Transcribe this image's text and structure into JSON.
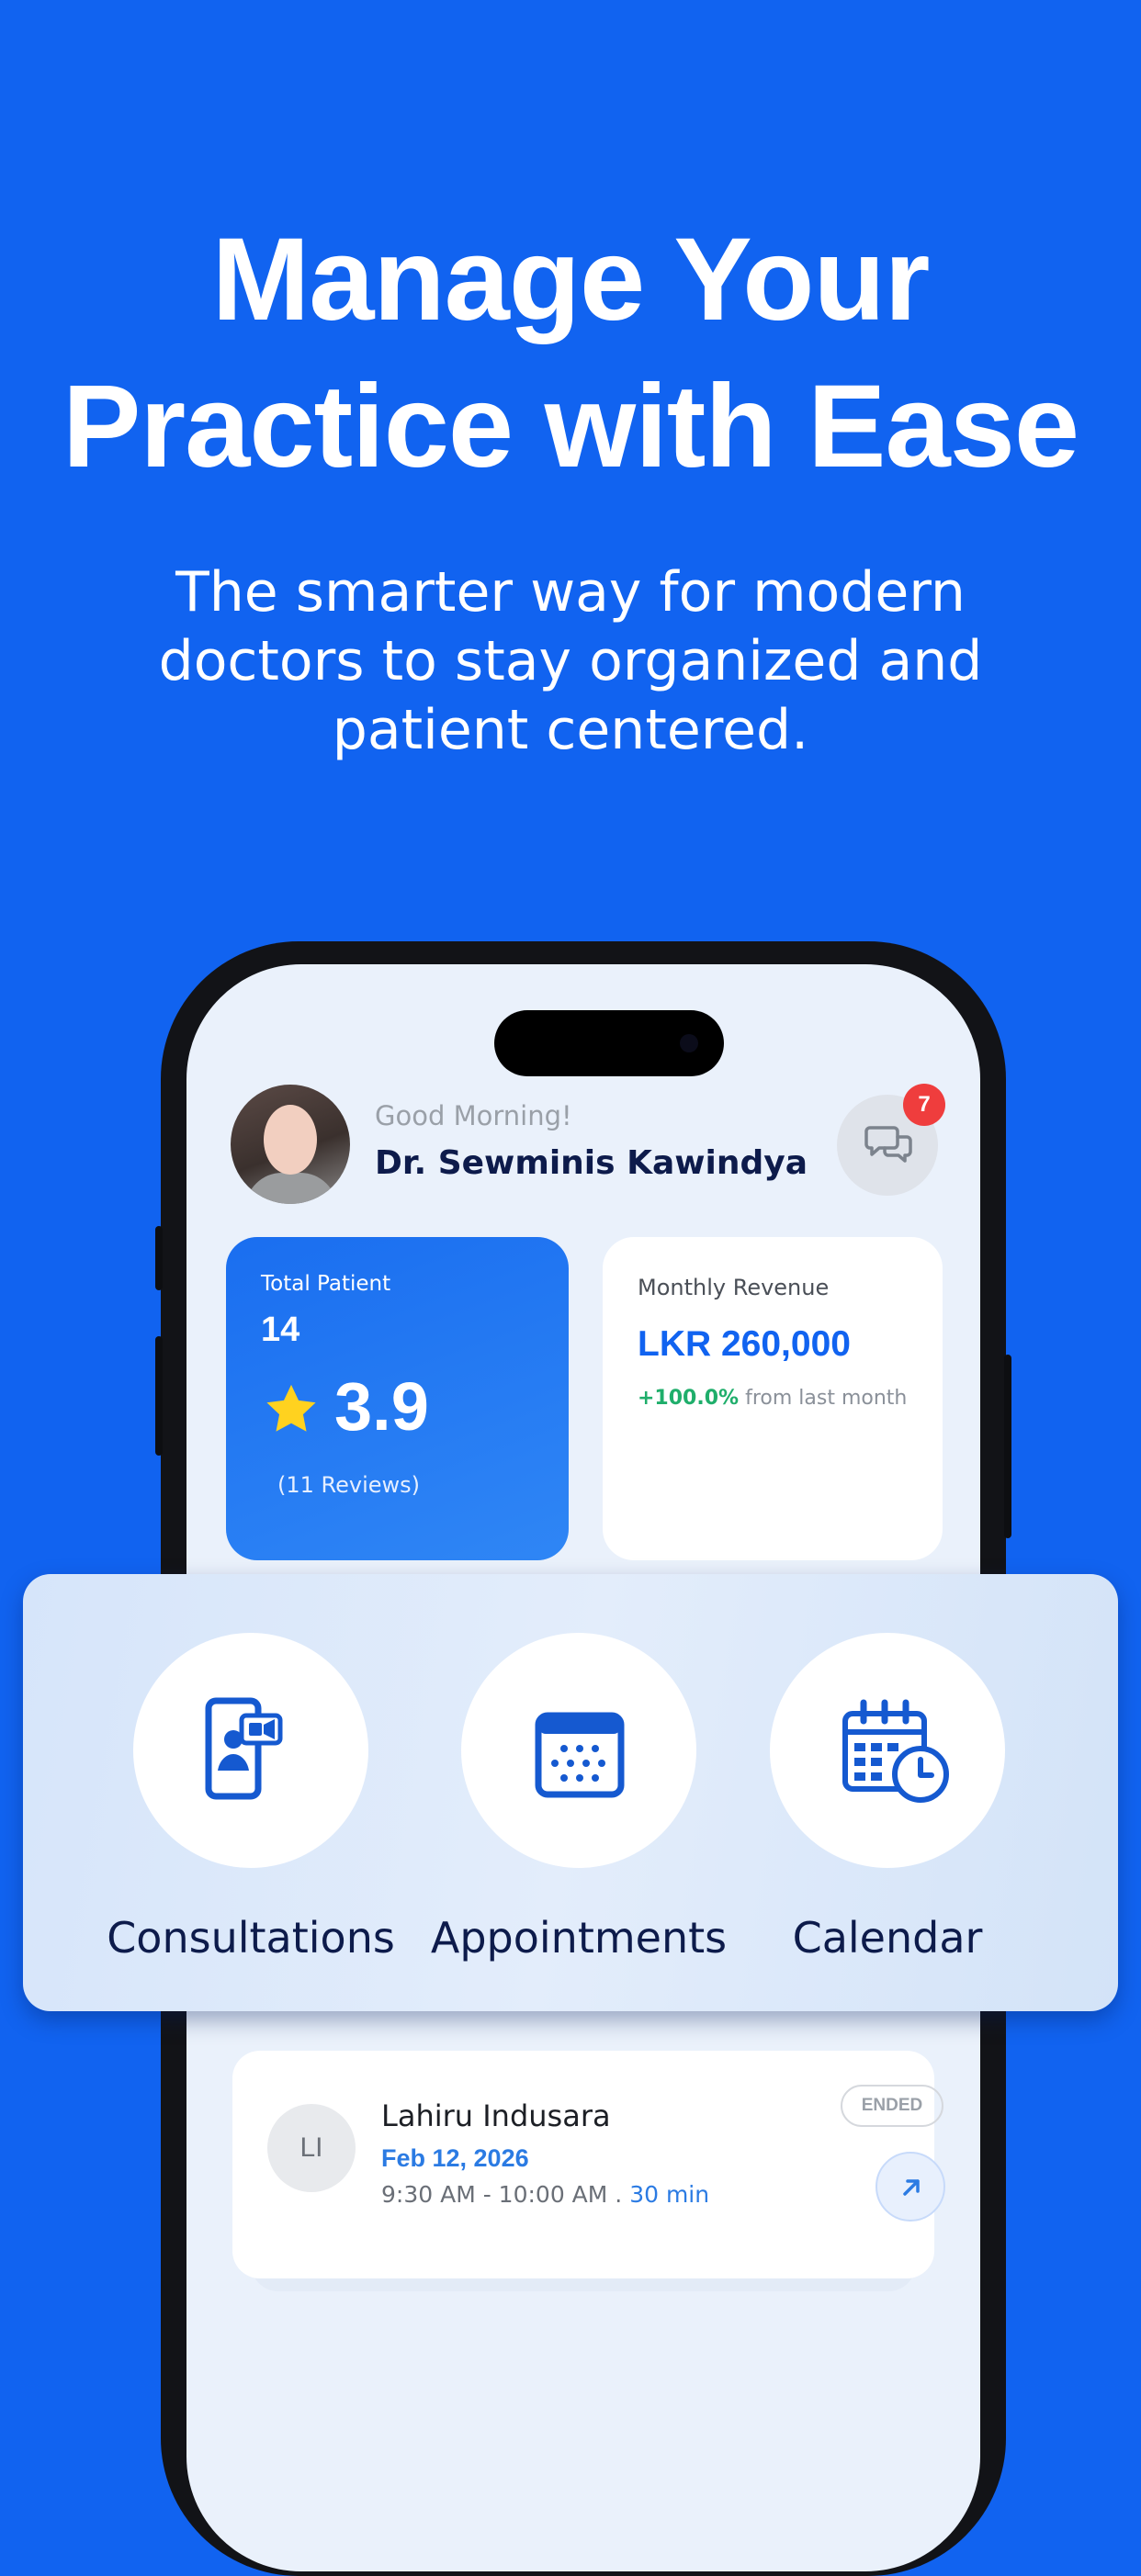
{
  "hero": {
    "title_line1": "Manage Your",
    "title_line2": "Practice with Ease",
    "subtitle_line1": "The smarter way for modern",
    "subtitle_line2": "doctors to stay organized and",
    "subtitle_line3": "patient centered."
  },
  "header": {
    "greeting": "Good Morning!",
    "doctor_name": "Dr. Sewminis Kawindya",
    "message_badge": "7"
  },
  "stats": {
    "patients_label": "Total Patient",
    "patients_value": "14",
    "rating": "3.9",
    "reviews": "(11 Reviews)",
    "revenue_label": "Monthly Revenue",
    "revenue_value": "LKR 260,000",
    "revenue_change": "+100.0%",
    "revenue_change_suffix": "from last month"
  },
  "quick_actions": [
    {
      "label": "Consultations",
      "icon": "video-consultation-icon"
    },
    {
      "label": "Appointments",
      "icon": "calendar-grid-icon"
    },
    {
      "label": "Calendar",
      "icon": "calendar-clock-icon"
    }
  ],
  "appointment": {
    "initials": "LI",
    "patient": "Lahiru Indusara",
    "date": "Feb 12, 2026",
    "time": "9:30 AM - 10:00 AM .",
    "duration": "30 min",
    "status": "ENDED"
  },
  "colors": {
    "brand_blue": "#1163F0",
    "success_green": "#1fae6b",
    "badge_red": "#ef3d3d",
    "navy_text": "#0d1b4b"
  }
}
